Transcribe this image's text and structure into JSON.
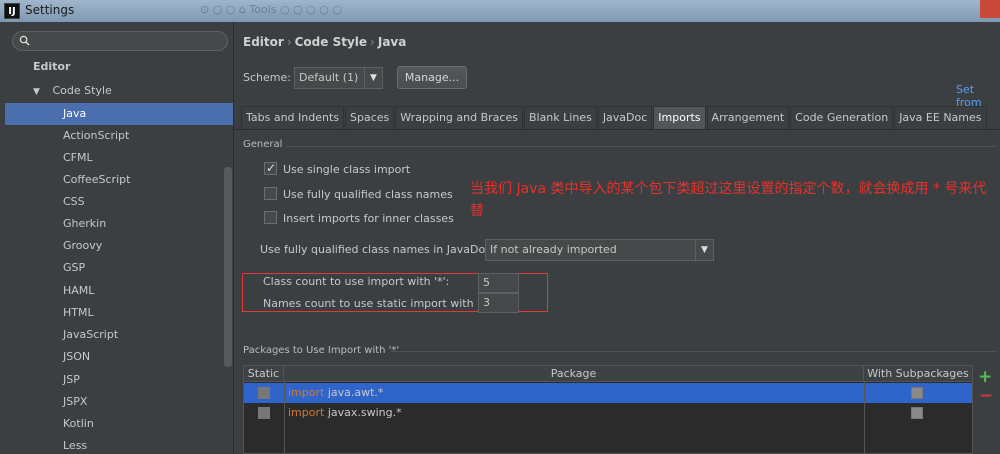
{
  "window": {
    "title": "Settings",
    "app_icon": "IJ",
    "ghost_tabs": "⊙ ○ ○ ⌂ Tools ○ ○ ○ ○ ○"
  },
  "sidebar": {
    "search_placeholder": "",
    "items": [
      {
        "label": "Editor"
      },
      {
        "label": "Code Style"
      },
      {
        "label": "Java"
      },
      {
        "label": "ActionScript"
      },
      {
        "label": "CFML"
      },
      {
        "label": "CoffeeScript"
      },
      {
        "label": "CSS"
      },
      {
        "label": "Gherkin"
      },
      {
        "label": "Groovy"
      },
      {
        "label": "GSP"
      },
      {
        "label": "HAML"
      },
      {
        "label": "HTML"
      },
      {
        "label": "JavaScript"
      },
      {
        "label": "JSON"
      },
      {
        "label": "JSP"
      },
      {
        "label": "JSPX"
      },
      {
        "label": "Kotlin"
      },
      {
        "label": "Less"
      }
    ]
  },
  "breadcrumb": {
    "part1": "Editor",
    "part2": "Code Style",
    "part3": "Java",
    "sep": "›"
  },
  "scheme": {
    "label": "Scheme:",
    "value": "Default (1)",
    "manage": "Manage...",
    "set_from": "Set from"
  },
  "tabs": [
    "Tabs and Indents",
    "Spaces",
    "Wrapping and Braces",
    "Blank Lines",
    "JavaDoc",
    "Imports",
    "Arrangement",
    "Code Generation",
    "Java EE Names"
  ],
  "general": {
    "title": "General",
    "single_import": "Use single class import",
    "fully_qualified": "Use fully qualified class names",
    "inner_classes": "Insert imports for inner classes",
    "javadoc_label": "Use fully qualified class names in JavaDoc:",
    "javadoc_value": "If not already imported",
    "class_count_label": "Class count to use import with '*':",
    "class_count": "5",
    "names_count_label": "Names count to use static import with '*':",
    "names_count": "3"
  },
  "note": "当我们 Java 类中导入的某个包下类超过这里设置的指定个数，就会换成用 * 号来代替",
  "packages": {
    "title": "Packages to Use Import with '*'",
    "headers": {
      "static": "Static",
      "package": "Package",
      "sub": "With Subpackages"
    },
    "rows": [
      {
        "kw": "import",
        "name": " java.awt.*"
      },
      {
        "kw": "import",
        "name": " javax.swing.*"
      }
    ],
    "plus": "+",
    "minus": "−"
  }
}
